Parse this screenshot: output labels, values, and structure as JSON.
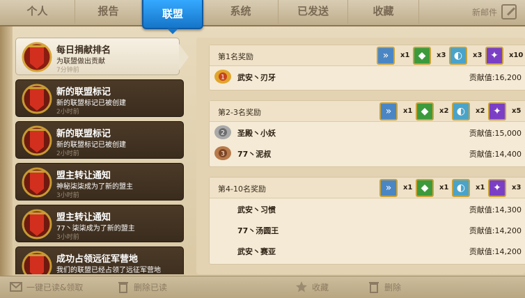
{
  "tabs": [
    {
      "label": "个人"
    },
    {
      "label": "报告"
    },
    {
      "label": "联盟"
    },
    {
      "label": "系统"
    },
    {
      "label": "已发送"
    },
    {
      "label": "收藏"
    }
  ],
  "new_mail_label": "新邮件",
  "mails": [
    {
      "title": "每日捐献排名",
      "sub": "为联盟做出贡献",
      "time": "7分钟前"
    },
    {
      "title": "新的联盟标记",
      "sub": "新的联盟标记已被创建",
      "time": "2小时前"
    },
    {
      "title": "新的联盟标记",
      "sub": "新的联盟标记已被创建",
      "time": "2小时前"
    },
    {
      "title": "盟主转让通知",
      "sub": "神秘柒柒成为了新的盟主",
      "time": "3小时前"
    },
    {
      "title": "盟主转让通知",
      "sub": "77丶柒柒成为了新的盟主",
      "time": "3小时前"
    },
    {
      "title": "成功占领远征军营地",
      "sub": "我们的联盟已经占领了远征军营地",
      "time": ""
    }
  ],
  "sections": [
    {
      "title": "第1名奖励",
      "rewards": [
        {
          "icon": "speedup-icon",
          "count": "x1"
        },
        {
          "icon": "shield-icon",
          "count": "x3"
        },
        {
          "icon": "horn-icon",
          "count": "x3"
        },
        {
          "icon": "crystal-icon",
          "count": "x10"
        }
      ],
      "rows": [
        {
          "rank": "1",
          "name": "武安丶刃牙",
          "label": "贡献值:",
          "value": "16,200"
        }
      ]
    },
    {
      "title": "第2-3名奖励",
      "rewards": [
        {
          "icon": "speedup-icon",
          "count": "x1"
        },
        {
          "icon": "shield-icon",
          "count": "x2"
        },
        {
          "icon": "horn-icon",
          "count": "x2"
        },
        {
          "icon": "crystal-icon",
          "count": "x5"
        }
      ],
      "rows": [
        {
          "rank": "2",
          "name": "圣殿丶小妖",
          "label": "贡献值:",
          "value": "15,000"
        },
        {
          "rank": "3",
          "name": "77丶泥叔",
          "label": "贡献值:",
          "value": "14,400"
        }
      ]
    },
    {
      "title": "第4-10名奖励",
      "rewards": [
        {
          "icon": "speedup-icon",
          "count": "x1"
        },
        {
          "icon": "shield-icon",
          "count": "x1"
        },
        {
          "icon": "horn-icon",
          "count": "x1"
        },
        {
          "icon": "crystal-icon",
          "count": "x3"
        }
      ],
      "rows": [
        {
          "rank": "",
          "name": "武安丶习惯",
          "label": "贡献值:",
          "value": "14,300"
        },
        {
          "rank": "",
          "name": "77丶汤圆王",
          "label": "贡献值:",
          "value": "14,200"
        },
        {
          "rank": "",
          "name": "武安丶赛亚",
          "label": "贡献值:",
          "value": "14,200"
        }
      ]
    }
  ],
  "bottom": {
    "read_all": "一键已读&领取",
    "delete_read": "删除已读",
    "favorite": "收藏",
    "delete": "删除"
  },
  "colors": {
    "tab_active": "#1675c8",
    "list_dark": "#3a2c1e",
    "panel_bg": "#e3d3b2"
  }
}
